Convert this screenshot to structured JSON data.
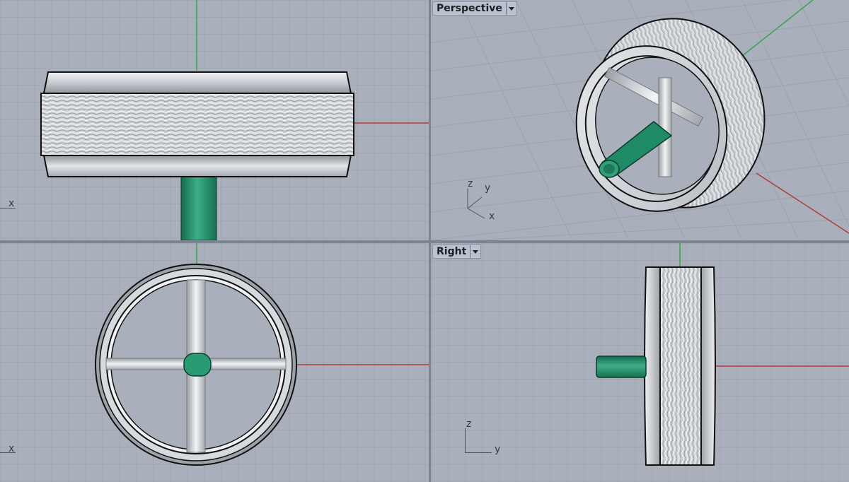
{
  "viewports": {
    "top": {
      "title": "",
      "axes": {
        "x": "x"
      }
    },
    "perspective": {
      "title": "Perspective",
      "axes": {
        "x": "x",
        "y": "y",
        "z": "z"
      }
    },
    "front": {
      "title": "",
      "axes": {
        "x": "x"
      }
    },
    "right": {
      "title": "Right",
      "axes": {
        "y": "y",
        "z": "z"
      }
    }
  },
  "colors": {
    "grid_bg": "#a9b0bb",
    "grid_minor": "#9aa2ae",
    "grid_major": "#8b94a1",
    "axis_x": "#b43a3a",
    "axis_y": "#3aa24a",
    "metal": "#d3d6da",
    "metal_dark": "#9ea3aa",
    "outline": "#111111",
    "stem": "#1f8a66"
  }
}
